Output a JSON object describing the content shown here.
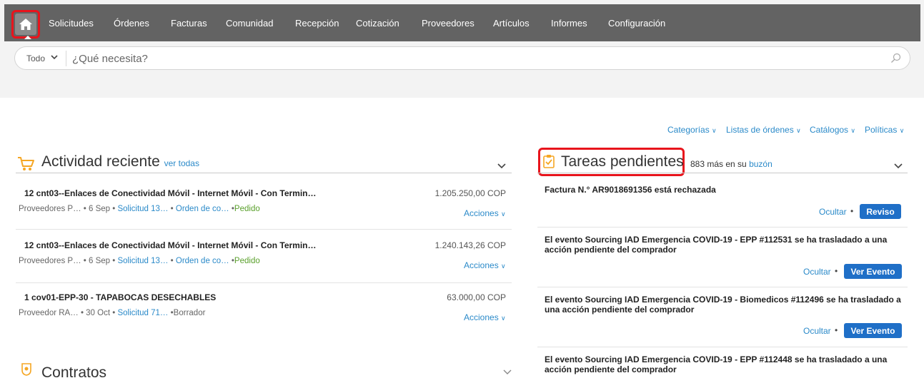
{
  "nav": {
    "items": [
      "Solicitudes",
      "Órdenes",
      "Facturas",
      "Comunidad",
      "Recepción",
      "Cotización",
      "Proveedores",
      "Artículos",
      "Informes",
      "Configuración"
    ]
  },
  "search": {
    "scope": "Todo",
    "placeholder": "¿Qué necesita?"
  },
  "links": {
    "categorias": "Categorías",
    "listas": "Listas de órdenes",
    "catalogos": "Catálogos",
    "politicas": "Políticas"
  },
  "actividad": {
    "title": "Actividad reciente",
    "ver_todas": "ver todas",
    "items": [
      {
        "title": "12 cnt03--Enlaces de Conectividad Móvil - Internet Móvil - Con Termin…",
        "amount": "1.205.250,00 COP",
        "supplier": "Proveedores P…",
        "date": "• 6 Sep •",
        "req": "Solicitud 13…",
        "order_dot": "•",
        "order": "Orden de co…",
        "status_dot": "•",
        "status": "Pedido",
        "action": "Acciones"
      },
      {
        "title": "12 cnt03--Enlaces de Conectividad Móvil - Internet Móvil - Con Termin…",
        "amount": "1.240.143,26 COP",
        "supplier": "Proveedores P…",
        "date": "• 6 Sep •",
        "req": "Solicitud 13…",
        "order_dot": "•",
        "order": "Orden de co…",
        "status_dot": "•",
        "status": "Pedido",
        "action": "Acciones"
      },
      {
        "title": "1 cov01-EPP-30 - TAPABOCAS DESECHABLES",
        "amount": "63.000,00 COP",
        "supplier": "Proveedor RA…",
        "date": "• 30 Oct •",
        "req": "Solicitud 71…",
        "status_dot": "•",
        "status": "Borrador",
        "action": "Acciones"
      }
    ]
  },
  "contratos": {
    "title": "Contratos"
  },
  "tareas": {
    "title": "Tareas pendientes",
    "more_prefix": "883 más en su",
    "more_link": "buzón",
    "items": [
      {
        "text": "Factura N.° AR9018691356 está rechazada",
        "hide": "Ocultar",
        "button": "Reviso"
      },
      {
        "text": "El evento Sourcing IAD Emergencia COVID-19 - EPP #112531 se ha trasladado a una acción pendiente del comprador",
        "hide": "Ocultar",
        "button": "Ver Evento"
      },
      {
        "text": "El evento Sourcing IAD Emergencia COVID-19 - Biomedicos #112496 se ha trasladado a una acción pendiente del comprador",
        "hide": "Ocultar",
        "button": "Ver Evento"
      },
      {
        "text": "El evento Sourcing IAD Emergencia COVID-19 - EPP #112448 se ha trasladado a una acción pendiente del comprador"
      }
    ]
  },
  "colors": {
    "nav_bg": "#636363",
    "link_blue": "#2b8ac9",
    "button_blue": "#1f6fc7",
    "highlight_red": "#e8141c",
    "status_green": "#5aa02c",
    "icon_orange": "#f5a623"
  }
}
